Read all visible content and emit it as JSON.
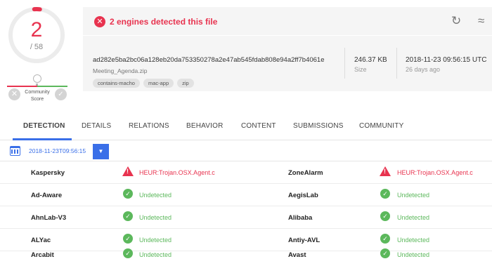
{
  "score": {
    "detected": "2",
    "total": "/ 58",
    "community_label": "Community Score"
  },
  "header": {
    "alert": "2 engines detected this file",
    "hash": "ad282e5ba2bc06a128eb20da753350278a2e47ab545fdab808e94a2ff7b4061e",
    "filename": "Meeting_Agenda.zip",
    "tags": [
      "contains-macho",
      "mac-app",
      "zip"
    ],
    "size_value": "246.37 KB",
    "size_label": "Size",
    "date_value": "2018-11-23 09:56:15 UTC",
    "date_label": "26 days ago"
  },
  "tabs": [
    "DETECTION",
    "DETAILS",
    "RELATIONS",
    "BEHAVIOR",
    "CONTENT",
    "SUBMISSIONS",
    "COMMUNITY"
  ],
  "date_selector": {
    "value": "2018-11-23T09:56:15"
  },
  "results": [
    {
      "left": {
        "engine": "Kaspersky",
        "result": "HEUR:Trojan.OSX.Agent.c",
        "status": "detected"
      },
      "right": {
        "engine": "ZoneAlarm",
        "result": "HEUR:Trojan.OSX.Agent.c",
        "status": "detected"
      }
    },
    {
      "left": {
        "engine": "Ad-Aware",
        "result": "Undetected",
        "status": "undetected"
      },
      "right": {
        "engine": "AegisLab",
        "result": "Undetected",
        "status": "undetected"
      }
    },
    {
      "left": {
        "engine": "AhnLab-V3",
        "result": "Undetected",
        "status": "undetected"
      },
      "right": {
        "engine": "Alibaba",
        "result": "Undetected",
        "status": "undetected"
      }
    },
    {
      "left": {
        "engine": "ALYac",
        "result": "Undetected",
        "status": "undetected"
      },
      "right": {
        "engine": "Antiy-AVL",
        "result": "Undetected",
        "status": "undetected"
      }
    },
    {
      "left": {
        "engine": "Arcabit",
        "result": "Undetected",
        "status": "undetected"
      },
      "right": {
        "engine": "Avast",
        "result": "Undetected",
        "status": "undetected"
      }
    }
  ],
  "colors": {
    "danger": "#e8334f",
    "success": "#5cb85c",
    "accent": "#3a6fe8"
  }
}
